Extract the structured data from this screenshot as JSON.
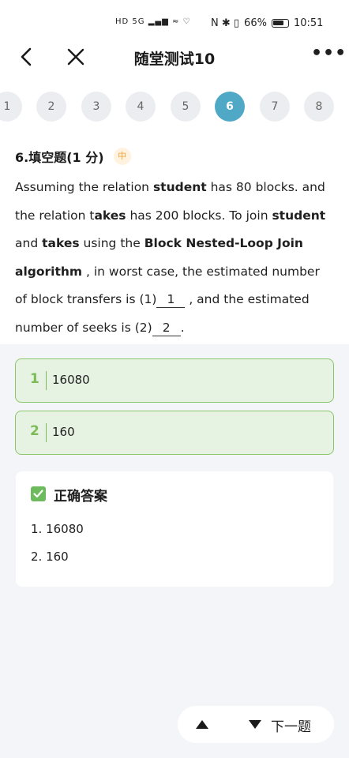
{
  "status_bar": {
    "left_icons": "HD 5G ▂▄▆ ≈ ♡",
    "right_icons": "N ✱ ▯",
    "battery": "66%",
    "time": "10:51"
  },
  "nav": {
    "title": "随堂测试10",
    "more": "•••"
  },
  "question_nav": {
    "items": [
      "1",
      "2",
      "3",
      "4",
      "5",
      "6",
      "7",
      "8"
    ],
    "active": "6"
  },
  "question": {
    "title": "6.填空题(1 分)",
    "difficulty": "中",
    "t1": "Assuming the relation ",
    "b1": "student",
    "t2": " has 80 blocks. and the relation t",
    "b2": "akes",
    "t3": " has 200 blocks. To join ",
    "b3": "student",
    "t4": " and ",
    "b4": "takes",
    "t5": " using the ",
    "b5": "Block Nested-Loop Join algorithm",
    "t6": " , in worst case, the estimated number of block transfers is (1)",
    "blank1": "1",
    "t7": " , and the estimated number of seeks is (2)",
    "blank2": "2",
    "t8": "."
  },
  "answers": [
    {
      "num": "1",
      "value": "16080"
    },
    {
      "num": "2",
      "value": "160"
    }
  ],
  "correct": {
    "title": "正确答案",
    "items": [
      "1. 16080",
      "2. 160"
    ]
  },
  "bottom": {
    "next_label": "下一题"
  },
  "colors": {
    "accent": "#4ea8c6",
    "answer_bg": "#e6f2e2",
    "answer_border": "#8cc66b",
    "check": "#6dbb5c"
  }
}
